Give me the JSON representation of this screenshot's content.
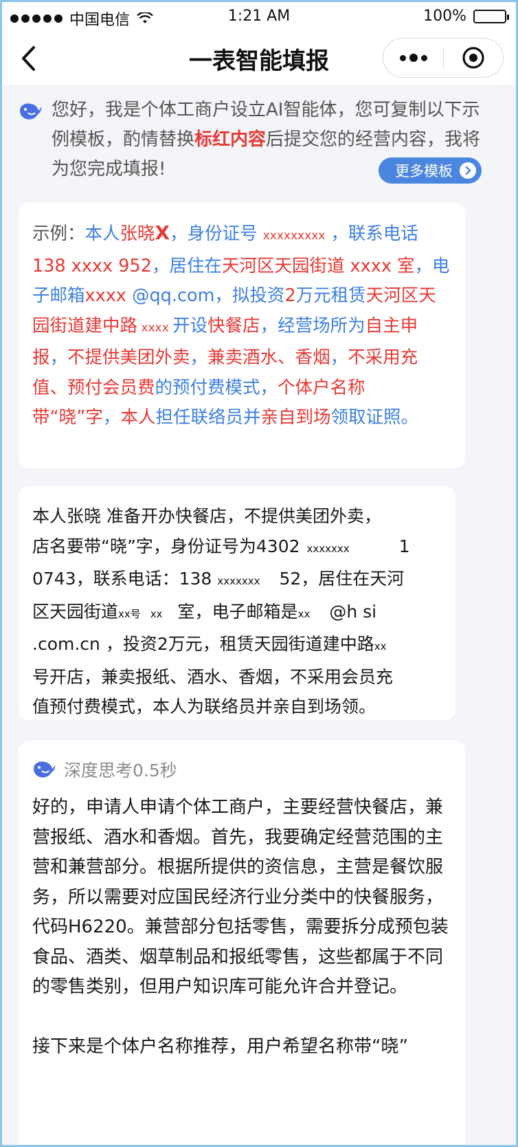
{
  "status_bar": {
    "carrier": "中国电信",
    "time": "1:21 AM",
    "battery": "100%"
  },
  "nav": {
    "title": "一表智能填报"
  },
  "intro": {
    "text_before": "您好，我是个体工商户设立AI智能体，您可复制以下示例模板，酌情替换",
    "highlight": "标红内容",
    "text_after": "后提交您的经营内容，我将为您完成填报!",
    "more_templates_label": "更多模板"
  },
  "example": {
    "label": "示例：",
    "segments": [
      {
        "t": "本人",
        "c": "b"
      },
      {
        "t": "张晓",
        "c": "r"
      },
      {
        "t": "X",
        "c": "xbig"
      },
      {
        "t": "，身份证号 ",
        "c": "b"
      },
      {
        "t": "  xxxxxxxxx",
        "c": "x"
      },
      {
        "t": "        ，联系电话",
        "c": "b"
      },
      {
        "t": "138",
        "c": "r"
      },
      {
        "t": "  xxxx  ",
        "c": "r"
      },
      {
        "t": " 952",
        "c": "r"
      },
      {
        "t": "，居住在",
        "c": "b"
      },
      {
        "t": "天河区天园街道",
        "c": "r"
      },
      {
        "t": " xxxx ",
        "c": "r"
      },
      {
        "t": "    室",
        "c": "r"
      },
      {
        "t": "，电子邮箱",
        "c": "b"
      },
      {
        "t": "xxxx",
        "c": "r"
      },
      {
        "t": " @qq.com，拟投资",
        "c": "b"
      },
      {
        "t": "2",
        "c": "r"
      },
      {
        "t": "万元租赁",
        "c": "b"
      },
      {
        "t": "天河区天园街道建中路",
        "c": "r"
      },
      {
        "t": " xxxx ",
        "c": "x"
      },
      {
        "t": "开设",
        "c": "b"
      },
      {
        "t": "快餐店",
        "c": "r"
      },
      {
        "t": "，经营场所为",
        "c": "b"
      },
      {
        "t": "自主申报",
        "c": "r"
      },
      {
        "t": "，",
        "c": "b"
      },
      {
        "t": "不提供美团外卖",
        "c": "r"
      },
      {
        "t": "，",
        "c": "b"
      },
      {
        "t": "兼卖酒水、香烟",
        "c": "r"
      },
      {
        "t": "，",
        "c": "b"
      },
      {
        "t": "不采用充值、预付会员费",
        "c": "r"
      },
      {
        "t": "的预付费模式",
        "c": "b"
      },
      {
        "t": "，",
        "c": "b"
      },
      {
        "t": "个体户名称带“晓”字",
        "c": "r"
      },
      {
        "t": "，",
        "c": "b"
      },
      {
        "t": "本人",
        "c": "r"
      },
      {
        "t": "担任联络员并",
        "c": "b"
      },
      {
        "t": "亲自到场",
        "c": "r"
      },
      {
        "t": "领取证照。",
        "c": "b"
      }
    ]
  },
  "user_message": {
    "lines": [
      "本人张晓    准备开办快餐店，不提供美团外卖，",
      "店名要带“晓”字，身份证号为4302",
      "0743，联系电话：138",
      "区天园街道",
      ".com.cn    ，投资2万元，租赁天园街道建中路",
      "号开店，兼卖报纸、酒水、香烟，不采用会员充",
      "值预付费模式，本人为联络员并亲自到场领。"
    ],
    "masks": {
      "m1": "xxxxxxx",
      "m1_tail": "1",
      "m2": "xxxxxxx",
      "m2_tail": "52，居住在天河",
      "m3": "xx号",
      "m4": "xx",
      "m4_tail": "室，电子邮箱是",
      "m5": "xx",
      "m5_tail": "@h   si",
      "m6": "xx"
    }
  },
  "reply": {
    "thinking_label": "深度思考0.5秒",
    "paragraphs": [
      "好的，申请人申请个体工商户，主要经营快餐店，兼营报纸、酒水和香烟。首先，我要确定经营范围的主营和兼营部分。根据所提供的资信息，主营是餐饮服务，所以需要对应国民经济行业分类中的快餐服务，代码H6220。兼营部分包括零售，需要拆分成预包装食品、酒类、烟草制品和报纸零售，这些都属于不同的零售类别，但用户知识库可能允许合并登记。",
      "接下来是个体户名称推荐，用户希望名称带“晓”"
    ]
  }
}
